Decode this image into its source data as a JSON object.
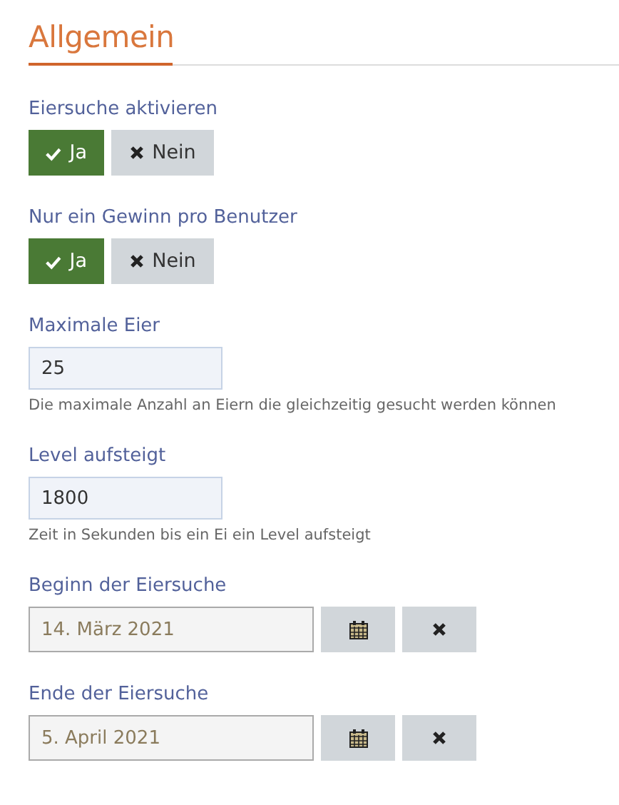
{
  "section": {
    "title": "Allgemein"
  },
  "fields": [
    {
      "kind": "toggle",
      "label": "Eiersuche aktivieren",
      "options": [
        {
          "label": "Ja",
          "selected": true
        },
        {
          "label": "Nein",
          "selected": false
        }
      ]
    },
    {
      "kind": "toggle",
      "label": "Nur ein Gewinn pro Benutzer",
      "options": [
        {
          "label": "Ja",
          "selected": true
        },
        {
          "label": "Nein",
          "selected": false
        }
      ]
    },
    {
      "kind": "number",
      "label": "Maximale Eier",
      "value": "25",
      "help": "Die maximale Anzahl an Eiern die gleichzeitig gesucht werden können"
    },
    {
      "kind": "number",
      "label": "Level aufsteigt",
      "value": "1800",
      "help": "Zeit in Sekunden bis ein Ei ein Level aufsteigt"
    },
    {
      "kind": "date",
      "label": "Beginn der Eiersuche",
      "value": "14. März 2021"
    },
    {
      "kind": "date",
      "label": "Ende der Eiersuche",
      "value": "5. April 2021"
    }
  ]
}
